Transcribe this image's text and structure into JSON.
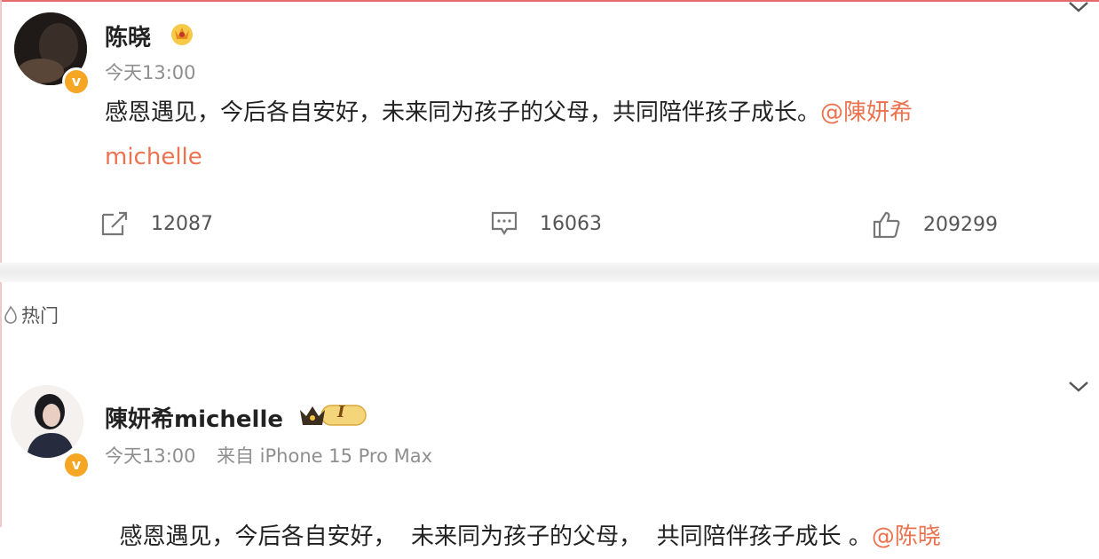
{
  "post": {
    "author": "陈晓",
    "time": "今天13:00",
    "text": "感恩遇见，今后各自安好，未来同为孩子的父母，共同陪伴孩子成长。",
    "mention": "@陳妍希",
    "mention_cont": "michelle",
    "repost_count": "12087",
    "comment_count": "16063",
    "like_count": "209299"
  },
  "section": {
    "hot_label": "热门"
  },
  "comment": {
    "author": "陳妍希michelle",
    "fan_level": "I",
    "time": "今天13:00",
    "source": "来自 iPhone 15 Pro Max",
    "text": "感恩遇见，今后各自安好，  未来同为孩子的父母，  共同陪伴孩子成长 。",
    "mention": "@陈晓"
  },
  "colors": {
    "mention": "#eb7350",
    "verified": "#f5a623",
    "meta": "#8f8f8f"
  }
}
